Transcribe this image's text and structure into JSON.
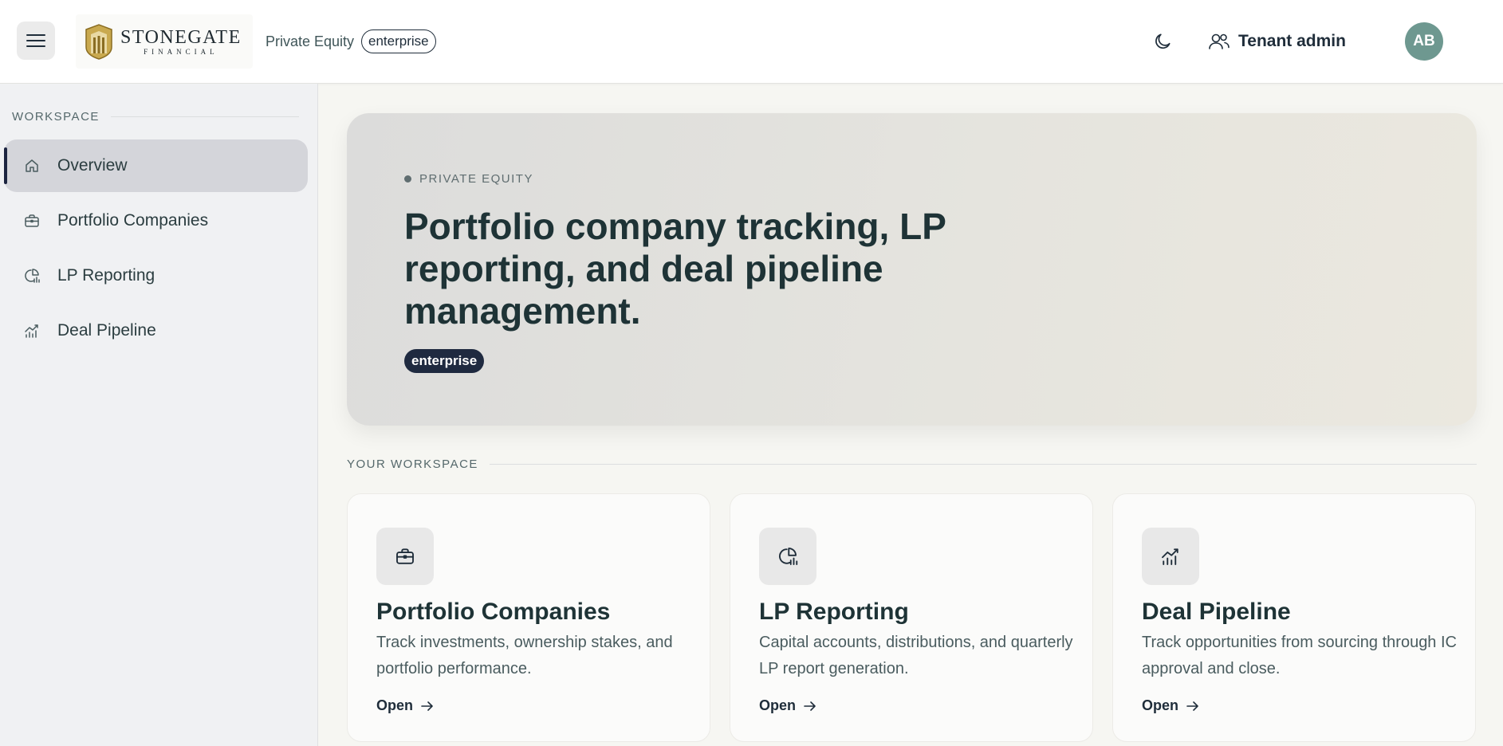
{
  "header": {
    "brand_name": "STONEGATE",
    "brand_sub": "FINANCIAL",
    "tenant_type": "Private Equity",
    "tier": "enterprise",
    "user_role": "Tenant admin",
    "avatar_initials": "AB"
  },
  "sidebar": {
    "heading": "WORKSPACE",
    "items": [
      {
        "label": "Overview",
        "icon": "home-icon",
        "active": true
      },
      {
        "label": "Portfolio Companies",
        "icon": "briefcase-icon",
        "active": false
      },
      {
        "label": "LP Reporting",
        "icon": "pie-chart-icon",
        "active": false
      },
      {
        "label": "Deal Pipeline",
        "icon": "trend-chart-icon",
        "active": false
      }
    ]
  },
  "hero": {
    "eyebrow": "PRIVATE EQUITY",
    "title": "Portfolio company tracking, LP reporting, and deal pipeline management.",
    "badge": "enterprise"
  },
  "workspace": {
    "heading": "YOUR WORKSPACE",
    "cards": [
      {
        "title": "Portfolio Companies",
        "description": "Track investments, ownership stakes, and portfolio performance.",
        "action": "Open",
        "icon": "briefcase-icon"
      },
      {
        "title": "LP Reporting",
        "description": "Capital accounts, distributions, and quarterly LP report generation.",
        "action": "Open",
        "icon": "pie-chart-icon"
      },
      {
        "title": "Deal Pipeline",
        "description": "Track opportunities from sourcing through IC approval and close.",
        "action": "Open",
        "icon": "trend-chart-icon"
      }
    ]
  },
  "colors": {
    "accent_dark": "#1f2a40",
    "avatar_bg": "#6e9890",
    "logo_gold": "#b8953a"
  }
}
